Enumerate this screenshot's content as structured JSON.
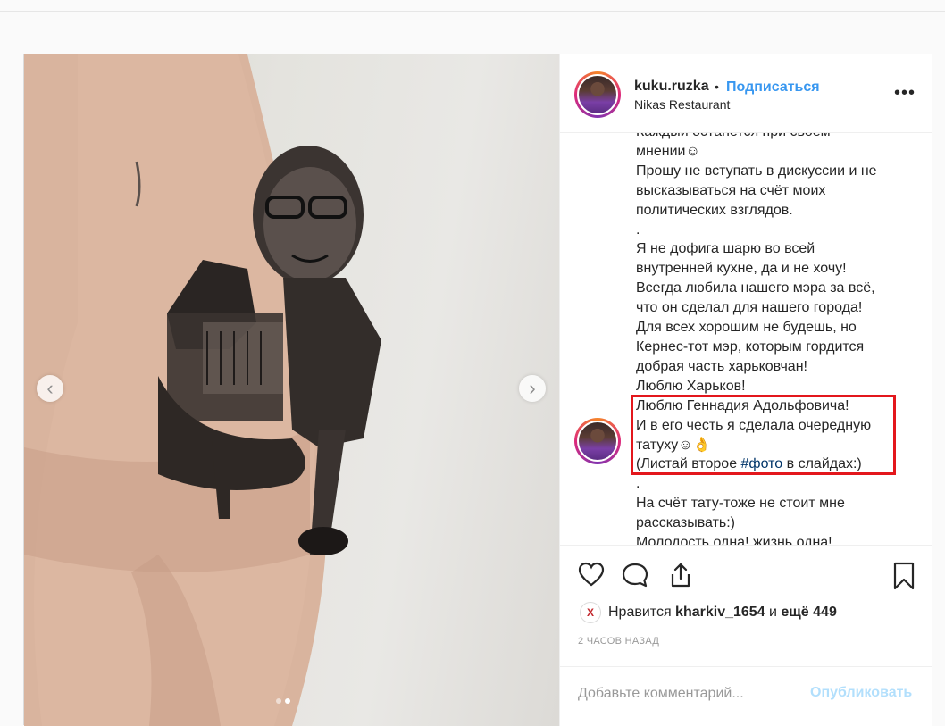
{
  "header": {
    "username": "kuku.ruzka",
    "separator": "•",
    "follow_label": "Подписаться",
    "location": "Nikas Restaurant",
    "more_glyph": "•••"
  },
  "caption": {
    "lines": [
      "Каждый останется при своём",
      "мнении☺",
      "Прошу не вступать в дискуссии и не",
      "высказываться на счёт моих",
      "политических взглядов.",
      ".",
      "Я не дофига шарю во всей",
      "внутренней кухне, да и не хочу!",
      "Всегда любила нашего мэра за всё,",
      "что он сделал для нашего города!",
      "Для всех хорошим не будешь, но",
      "Кернес-тот мэр, которым гордится",
      "добрая часть харьковчан!",
      "Люблю Харьков!",
      "Люблю Геннадия Адольфовича!",
      "И в его честь я сделала очередную",
      "татуху☺👌",
      "(Листай второе ",
      ".",
      "На счёт тату-тоже не стоит мне",
      "рассказывать:)",
      "Молодость одна! жизнь одна!"
    ],
    "hashtag": "#фото",
    "after_hashtag": " в слайдах:)"
  },
  "carousel": {
    "prev_glyph": "‹",
    "next_glyph": "›",
    "slide_count": 2,
    "active_slide": 2
  },
  "likes": {
    "badge": "Х",
    "prefix": "Нравится ",
    "user": "kharkiv_1654",
    "middle": " и ",
    "others": "ещё 449"
  },
  "time_ago": "2 ЧАСОВ НАЗАД",
  "comment": {
    "placeholder": "Добавьте комментарий...",
    "publish_label": "Опубликовать"
  },
  "icons": [
    "heart-icon",
    "comment-icon",
    "share-icon",
    "bookmark-icon"
  ],
  "colors": {
    "accent": "#3897f0",
    "highlight": "#e3171c",
    "publish_disabled": "#b2dffc"
  }
}
